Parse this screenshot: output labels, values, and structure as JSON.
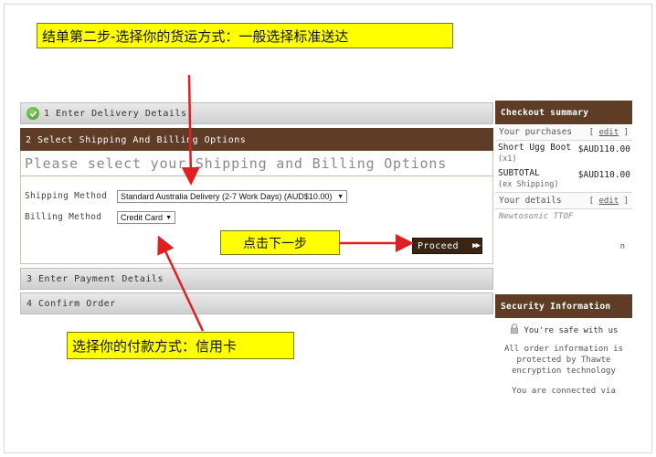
{
  "annotations": {
    "step_title": "结单第二步-选择你的货运方式：一般选择标准送达",
    "click_next": "点击下一步",
    "payment_note": "选择你的付款方式：信用卡"
  },
  "steps": {
    "step1": "1 Enter Delivery Details",
    "step2": "2 Select Shipping And Billing Options",
    "step3": "3 Enter Payment Details",
    "step4": "4 Confirm Order"
  },
  "form": {
    "heading": "Please select your Shipping and Billing Options",
    "shipping_label": "Shipping Method",
    "shipping_value": "Standard Australia Delivery (2-7 Work Days) (AUD$10.00)",
    "billing_label": "Billing Method",
    "billing_value": "Credit Card",
    "proceed_label": "Proceed"
  },
  "summary": {
    "title": "Checkout summary",
    "purchases_label": "Your purchases",
    "edit_label": "edit",
    "item_name": "Short Ugg Boot",
    "item_qty": "(x1)",
    "item_price": "$AUD110.00",
    "subtotal_label": "SUBTOTAL",
    "subtotal_note": "(ex Shipping)",
    "subtotal_price": "$AUD110.00",
    "details_label": "Your details",
    "details_name": "Newtosonic TTOF",
    "details_extra": "n"
  },
  "security": {
    "title": "Security Information",
    "safe_text": "You're safe with us",
    "body": "All order information is protected by Thawte encryption technology",
    "cut_text": "You are connected via"
  },
  "colors": {
    "brown": "#5e3c26",
    "callout_yellow": "#ffff00",
    "arrow_red": "#e02020"
  }
}
